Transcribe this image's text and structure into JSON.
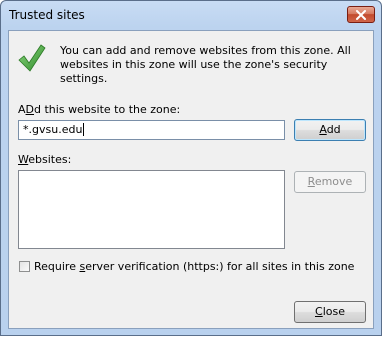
{
  "window": {
    "title": "Trusted sites"
  },
  "info": {
    "message": "You can add and remove websites from this zone. All websites in this zone will use the zone's security settings."
  },
  "add_section": {
    "label_prefix": "",
    "label_access": "D",
    "label_rest": "d this website to the zone:",
    "label_first": "A",
    "input_value": "*.gvsu.edu",
    "add_button_access": "A",
    "add_button_rest": "dd"
  },
  "websites_section": {
    "label_access": "W",
    "label_rest": "ebsites:",
    "remove_button_access": "R",
    "remove_button_rest": "emove",
    "items": []
  },
  "options": {
    "require_https_before": "Require ",
    "require_https_access": "s",
    "require_https_after": "erver verification (https:) for all sites in this zone",
    "require_https_checked": false
  },
  "footer": {
    "close_access": "C",
    "close_rest": "lose"
  },
  "colors": {
    "title_gradient_top": "#c8dcf4",
    "close_button": "#c24a2c",
    "check_green": "#3fa43a",
    "dialog_bg": "#f0f0f0"
  }
}
